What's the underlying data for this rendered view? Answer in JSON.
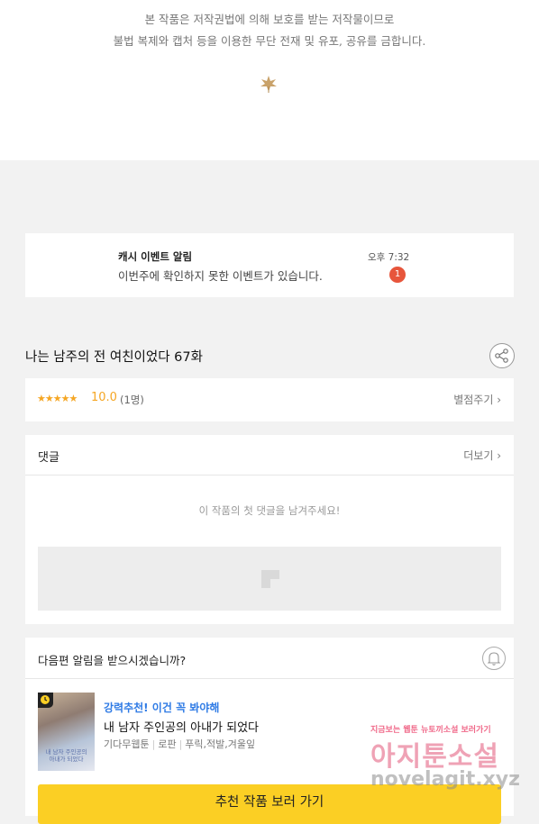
{
  "copyright": {
    "line1": "본 작품은 저작권법에 의해 보호를 받는 저작물이므로",
    "line2": "불법 복제와 캡처 등을 이용한 무단 전재 및 유포, 공유를 금합니다."
  },
  "notification": {
    "title": "캐시 이벤트 알림",
    "message": "이번주에 확인하지 못한 이벤트가 있습니다.",
    "time": "오후 7:32",
    "badge": "1"
  },
  "episode": {
    "title": "나는 남주의 전 여친이었다 67화"
  },
  "rating": {
    "stars": "★★★★★",
    "score": "10.0",
    "count": "(1명)",
    "rate_link": "별점주기 ›"
  },
  "comments": {
    "title": "댓글",
    "more": "더보기 ›",
    "empty": "이 작품의 첫 댓글을 남겨주세요!"
  },
  "next_episode": {
    "prompt": "다음편 알림을 받으시겠습니까?",
    "recommend_label": "강력추천! 이건 꼭 봐야해",
    "recommend_title": "내 남자 주인공의 아내가 되었다",
    "meta": [
      "기다무웹툰",
      "로판",
      "푸릭,적발,겨울잎"
    ],
    "thumb_text": "내 남자 주인공의 아내가 되었다",
    "cta": "추천 작품 보러 가기"
  },
  "watermark": {
    "line1": "지금보는 웹툰 뉴토끼소설 보러가기",
    "line2": "아지툰소설",
    "line3": "novelagit.xyz"
  },
  "colors": {
    "accent_yellow": "#fbcf24",
    "badge_red": "#e7553b",
    "star": "#f5a623",
    "link_blue": "#2f7be5"
  },
  "icons": [
    "leaf-ornament-icon",
    "share-icon",
    "image-placeholder-icon",
    "bell-icon",
    "clock-badge-icon"
  ]
}
